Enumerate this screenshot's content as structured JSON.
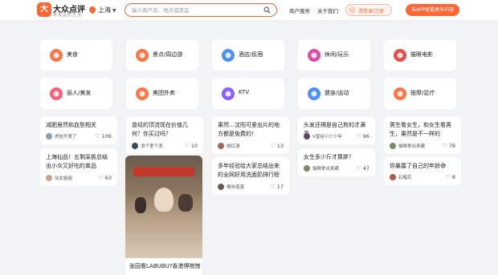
{
  "header": {
    "logo_text": "大众点评",
    "logo_sub": "发现品质生活",
    "logo_mark": "大",
    "city": "上海",
    "search_placeholder": "输入商户名、地点或菜品",
    "nav": [
      "商户服务",
      "关于我们"
    ],
    "login": "请登录/注册",
    "app_button": "去APP查看更多内容"
  },
  "categories": [
    {
      "label": "美食",
      "icon": "food-icon",
      "color": "#ff6633"
    },
    {
      "label": "景点/周边游",
      "icon": "scenic-icon",
      "color": "#ff6633"
    },
    {
      "label": "酒店/民宿",
      "icon": "hotel-icon",
      "color": "#3b82f6"
    },
    {
      "label": "休闲/玩乐",
      "icon": "cocktail-icon",
      "color": "#d63aa0"
    },
    {
      "label": "猫眼电影",
      "icon": "cat-eye-icon",
      "color": "#e53935"
    },
    {
      "label": "丽人/美发",
      "icon": "beauty-icon",
      "color": "#ff4d6d"
    },
    {
      "label": "美团外卖",
      "icon": "delivery-icon",
      "color": "#ff6633"
    },
    {
      "label": "KTV",
      "icon": "ktv-icon",
      "color": "#7b4dff"
    },
    {
      "label": "健身/运动",
      "icon": "fitness-icon",
      "color": "#3b82f6"
    },
    {
      "label": "按摩/足疗",
      "icon": "massage-icon",
      "color": "#ff6633"
    }
  ],
  "cards": [
    {
      "title": "减肥居然和血型相关",
      "author": "虎娃开爱了",
      "likes": "106",
      "av": "#8aa0b8"
    },
    {
      "title": "上海仙品！五剩呆板总结出小众又好吃的单品",
      "author": "仙女姐姐",
      "likes": "63",
      "av": "#caa58c"
    },
    {
      "title": "曾经的顶流现在价值几何？你买过吗？",
      "author": "浪个里个浪",
      "likes": "10",
      "av": "#3c4a5c"
    },
    {
      "title": "果然…沈阳可爱出片的地方都是免费的！",
      "author": "姚红潇",
      "likes": "13",
      "av": "#9a6a5a"
    },
    {
      "title": "多年经验给大家总结出来的全网好用洗面奶排行榜",
      "author": "嘟听南落",
      "likes": "17",
      "av": "#6a5a50"
    },
    {
      "title": "头发还得是自己剪的才满意",
      "author": "V曾经小少少年",
      "likes": "96",
      "av": "#5a4a66"
    },
    {
      "title": "女生多少斤才算胖？",
      "author": "猫粮拿出来藏",
      "likes": "47",
      "av": "#7a8a6a"
    },
    {
      "title": "男生看女生，和女生看男生，果然是不一样的",
      "author": "猫粮拿出来藏",
      "likes": "78",
      "av": "#7a8a6a"
    },
    {
      "title": "你暴露了自己的年龄😅",
      "author": "石榴花",
      "likes": "8",
      "av": "#b05a4a"
    }
  ],
  "image_card": {
    "title": "张园看LABUBU?香港博物馆"
  }
}
